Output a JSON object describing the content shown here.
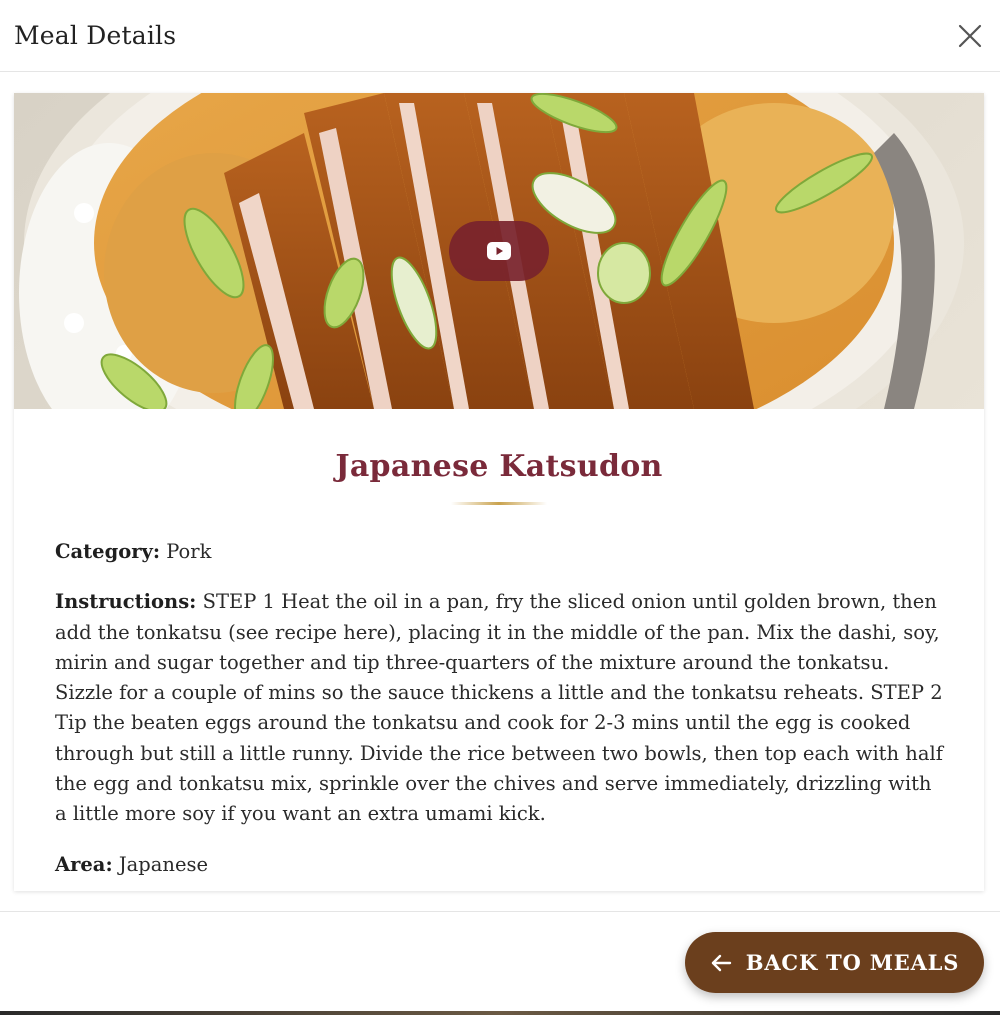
{
  "modal": {
    "title": "Meal Details"
  },
  "meal": {
    "name": "Japanese Katsudon",
    "category_label": "Category:",
    "category": "Pork",
    "instructions_label": "Instructions:",
    "instructions": "STEP 1 Heat the oil in a pan, fry the sliced onion until golden brown, then add the tonkatsu (see recipe here), placing it in the middle of the pan. Mix the dashi, soy, mirin and sugar together and tip three-quarters of the mixture around the tonkatsu. Sizzle for a couple of mins so the sauce thickens a little and the tonkatsu reheats. STEP 2 Tip the beaten eggs around the tonkatsu and cook for 2-3 mins until the egg is cooked through but still a little runny. Divide the rice between two bowls, then top each with half the egg and tonkatsu mix, sprinkle over the chives and serve immediately, drizzling with a little more soy if you want an extra umami kick.",
    "area_label": "Area:",
    "area": "Japanese"
  },
  "footer": {
    "back_label": "BACK TO MEALS"
  },
  "icons": {
    "close": "close-icon",
    "play": "youtube-play-icon",
    "back": "arrow-left-icon"
  },
  "colors": {
    "title": "#7a2a3a",
    "play_button": "#78232d",
    "back_button": "#6b3f1d",
    "accent_rule": "#c9a24d"
  }
}
